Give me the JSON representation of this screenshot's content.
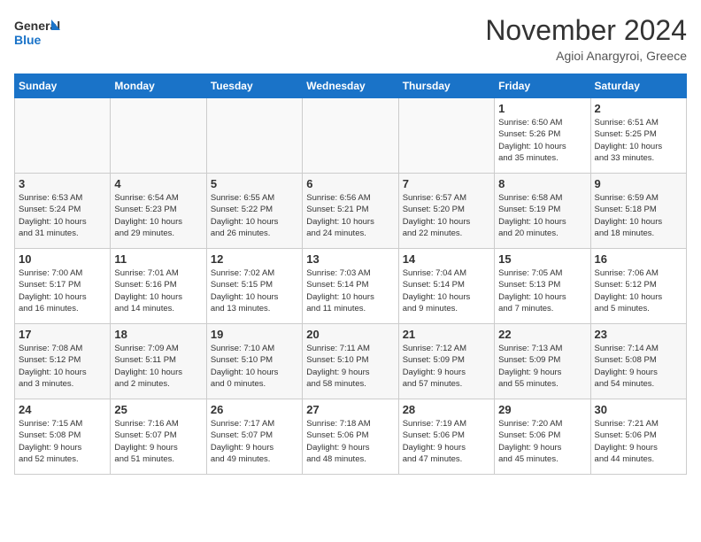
{
  "header": {
    "logo_line1": "General",
    "logo_line2": "Blue",
    "month": "November 2024",
    "location": "Agioi Anargyroi, Greece"
  },
  "weekdays": [
    "Sunday",
    "Monday",
    "Tuesday",
    "Wednesday",
    "Thursday",
    "Friday",
    "Saturday"
  ],
  "weeks": [
    [
      {
        "day": "",
        "info": ""
      },
      {
        "day": "",
        "info": ""
      },
      {
        "day": "",
        "info": ""
      },
      {
        "day": "",
        "info": ""
      },
      {
        "day": "",
        "info": ""
      },
      {
        "day": "1",
        "info": "Sunrise: 6:50 AM\nSunset: 5:26 PM\nDaylight: 10 hours\nand 35 minutes."
      },
      {
        "day": "2",
        "info": "Sunrise: 6:51 AM\nSunset: 5:25 PM\nDaylight: 10 hours\nand 33 minutes."
      }
    ],
    [
      {
        "day": "3",
        "info": "Sunrise: 6:53 AM\nSunset: 5:24 PM\nDaylight: 10 hours\nand 31 minutes."
      },
      {
        "day": "4",
        "info": "Sunrise: 6:54 AM\nSunset: 5:23 PM\nDaylight: 10 hours\nand 29 minutes."
      },
      {
        "day": "5",
        "info": "Sunrise: 6:55 AM\nSunset: 5:22 PM\nDaylight: 10 hours\nand 26 minutes."
      },
      {
        "day": "6",
        "info": "Sunrise: 6:56 AM\nSunset: 5:21 PM\nDaylight: 10 hours\nand 24 minutes."
      },
      {
        "day": "7",
        "info": "Sunrise: 6:57 AM\nSunset: 5:20 PM\nDaylight: 10 hours\nand 22 minutes."
      },
      {
        "day": "8",
        "info": "Sunrise: 6:58 AM\nSunset: 5:19 PM\nDaylight: 10 hours\nand 20 minutes."
      },
      {
        "day": "9",
        "info": "Sunrise: 6:59 AM\nSunset: 5:18 PM\nDaylight: 10 hours\nand 18 minutes."
      }
    ],
    [
      {
        "day": "10",
        "info": "Sunrise: 7:00 AM\nSunset: 5:17 PM\nDaylight: 10 hours\nand 16 minutes."
      },
      {
        "day": "11",
        "info": "Sunrise: 7:01 AM\nSunset: 5:16 PM\nDaylight: 10 hours\nand 14 minutes."
      },
      {
        "day": "12",
        "info": "Sunrise: 7:02 AM\nSunset: 5:15 PM\nDaylight: 10 hours\nand 13 minutes."
      },
      {
        "day": "13",
        "info": "Sunrise: 7:03 AM\nSunset: 5:14 PM\nDaylight: 10 hours\nand 11 minutes."
      },
      {
        "day": "14",
        "info": "Sunrise: 7:04 AM\nSunset: 5:14 PM\nDaylight: 10 hours\nand 9 minutes."
      },
      {
        "day": "15",
        "info": "Sunrise: 7:05 AM\nSunset: 5:13 PM\nDaylight: 10 hours\nand 7 minutes."
      },
      {
        "day": "16",
        "info": "Sunrise: 7:06 AM\nSunset: 5:12 PM\nDaylight: 10 hours\nand 5 minutes."
      }
    ],
    [
      {
        "day": "17",
        "info": "Sunrise: 7:08 AM\nSunset: 5:12 PM\nDaylight: 10 hours\nand 3 minutes."
      },
      {
        "day": "18",
        "info": "Sunrise: 7:09 AM\nSunset: 5:11 PM\nDaylight: 10 hours\nand 2 minutes."
      },
      {
        "day": "19",
        "info": "Sunrise: 7:10 AM\nSunset: 5:10 PM\nDaylight: 10 hours\nand 0 minutes."
      },
      {
        "day": "20",
        "info": "Sunrise: 7:11 AM\nSunset: 5:10 PM\nDaylight: 9 hours\nand 58 minutes."
      },
      {
        "day": "21",
        "info": "Sunrise: 7:12 AM\nSunset: 5:09 PM\nDaylight: 9 hours\nand 57 minutes."
      },
      {
        "day": "22",
        "info": "Sunrise: 7:13 AM\nSunset: 5:09 PM\nDaylight: 9 hours\nand 55 minutes."
      },
      {
        "day": "23",
        "info": "Sunrise: 7:14 AM\nSunset: 5:08 PM\nDaylight: 9 hours\nand 54 minutes."
      }
    ],
    [
      {
        "day": "24",
        "info": "Sunrise: 7:15 AM\nSunset: 5:08 PM\nDaylight: 9 hours\nand 52 minutes."
      },
      {
        "day": "25",
        "info": "Sunrise: 7:16 AM\nSunset: 5:07 PM\nDaylight: 9 hours\nand 51 minutes."
      },
      {
        "day": "26",
        "info": "Sunrise: 7:17 AM\nSunset: 5:07 PM\nDaylight: 9 hours\nand 49 minutes."
      },
      {
        "day": "27",
        "info": "Sunrise: 7:18 AM\nSunset: 5:06 PM\nDaylight: 9 hours\nand 48 minutes."
      },
      {
        "day": "28",
        "info": "Sunrise: 7:19 AM\nSunset: 5:06 PM\nDaylight: 9 hours\nand 47 minutes."
      },
      {
        "day": "29",
        "info": "Sunrise: 7:20 AM\nSunset: 5:06 PM\nDaylight: 9 hours\nand 45 minutes."
      },
      {
        "day": "30",
        "info": "Sunrise: 7:21 AM\nSunset: 5:06 PM\nDaylight: 9 hours\nand 44 minutes."
      }
    ]
  ]
}
